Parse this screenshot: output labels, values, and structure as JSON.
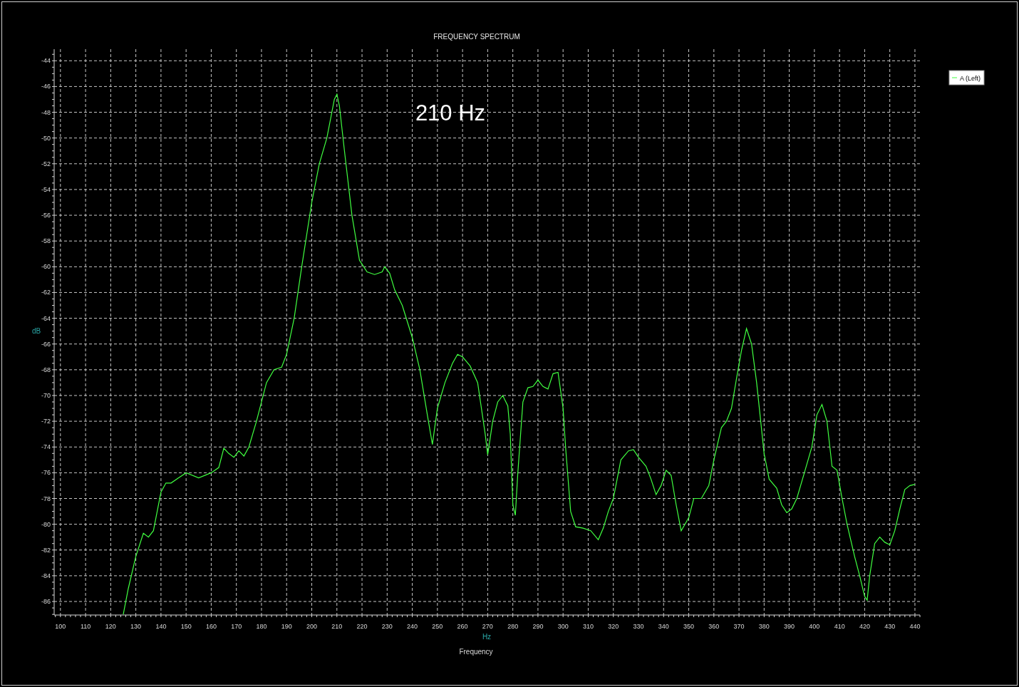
{
  "chart": {
    "x_unit": "Hz",
    "chart_data": {
      "type": "line",
      "title": "FREQUENCY SPECTRUM",
      "xlabel": "Frequency",
      "ylabel": "dB",
      "x": [
        125,
        127,
        130,
        133,
        135,
        137,
        140,
        142,
        144,
        147,
        150,
        155,
        160,
        163,
        165,
        167,
        169,
        171,
        173,
        175,
        178,
        182,
        185,
        188,
        190,
        193,
        196,
        200,
        203,
        206,
        209,
        210,
        211,
        213,
        216,
        219,
        222,
        225,
        228,
        229,
        231,
        233,
        236,
        240,
        243,
        246,
        248,
        250,
        253,
        256,
        258,
        260,
        263,
        266,
        269,
        270,
        272,
        274,
        276,
        278,
        279,
        280,
        281,
        282,
        284,
        286,
        288,
        290,
        292,
        294,
        296,
        298,
        300,
        301,
        303,
        305,
        308,
        311,
        314,
        316,
        318,
        320,
        323,
        326,
        328,
        330,
        333,
        335,
        337,
        339,
        341,
        343,
        345,
        347,
        350,
        352,
        355,
        358,
        360,
        363,
        365,
        367,
        369,
        371,
        373,
        375,
        377,
        380,
        382,
        385,
        387,
        389,
        391,
        393,
        396,
        399,
        401,
        403,
        405,
        407,
        409,
        411,
        413,
        416,
        418,
        420,
        421,
        422,
        424,
        426,
        428,
        430,
        432,
        434,
        436,
        438,
        440
      ],
      "series": [
        {
          "name": "A (Left)",
          "color": "#40ff40",
          "values": [
            -87.0,
            -85,
            -82.5,
            -80.7,
            -81,
            -80.5,
            -77.5,
            -76.8,
            -76.8,
            -76.4,
            -76.0,
            -76.4,
            -76.0,
            -75.6,
            -74.1,
            -74.5,
            -74.8,
            -74.3,
            -74.7,
            -74.0,
            -72.0,
            -69.0,
            -68.0,
            -67.8,
            -66.8,
            -64,
            -60,
            -55,
            -52,
            -50,
            -47,
            -46.6,
            -47.5,
            -51,
            -56,
            -59.5,
            -60.4,
            -60.6,
            -60.4,
            -60.0,
            -60.5,
            -61.8,
            -63,
            -65.5,
            -68,
            -71.5,
            -73.8,
            -71,
            -69,
            -67.5,
            -66.8,
            -67.0,
            -67.7,
            -69,
            -73,
            -74.6,
            -72,
            -70.5,
            -70,
            -70.8,
            -73,
            -78.5,
            -79.3,
            -76,
            -70.5,
            -69.4,
            -69.3,
            -68.8,
            -69.3,
            -69.5,
            -68.3,
            -68.2,
            -71,
            -74,
            -79,
            -80.2,
            -80.3,
            -80.5,
            -81.2,
            -80.3,
            -79,
            -78,
            -75,
            -74.3,
            -74.2,
            -74.8,
            -75.5,
            -76.5,
            -77.7,
            -77,
            -75.8,
            -76.2,
            -78.5,
            -80.5,
            -79.5,
            -78,
            -78,
            -77,
            -75,
            -72.5,
            -72,
            -71,
            -68.7,
            -66.5,
            -64.8,
            -66,
            -69,
            -74.5,
            -76.5,
            -77.2,
            -78.5,
            -79.1,
            -78.8,
            -78,
            -76,
            -74,
            -71.5,
            -70.7,
            -72,
            -75.5,
            -75.8,
            -78,
            -80,
            -82.5,
            -84,
            -85.6,
            -85.9,
            -84,
            -81.5,
            -81.0,
            -81.4,
            -81.6,
            -80.5,
            -78.8,
            -77.3,
            -77.0,
            -76.9
          ]
        }
      ],
      "xlim": [
        97.5,
        442
      ],
      "ylim": [
        -87.05,
        -43.1
      ],
      "xticks": [
        100,
        110,
        120,
        130,
        140,
        150,
        160,
        170,
        180,
        190,
        200,
        210,
        220,
        230,
        240,
        250,
        260,
        270,
        280,
        290,
        300,
        310,
        320,
        330,
        340,
        350,
        360,
        370,
        380,
        390,
        400,
        410,
        420,
        430,
        440
      ],
      "yticks": [
        -44,
        -46,
        -48,
        -50,
        -52,
        -54,
        -56,
        -58,
        -60,
        -62,
        -64,
        -66,
        -68,
        -70,
        -72,
        -74,
        -76,
        -78,
        -80,
        -82,
        -84,
        -86
      ],
      "grid": true,
      "annotations": [
        "210 Hz"
      ]
    }
  }
}
